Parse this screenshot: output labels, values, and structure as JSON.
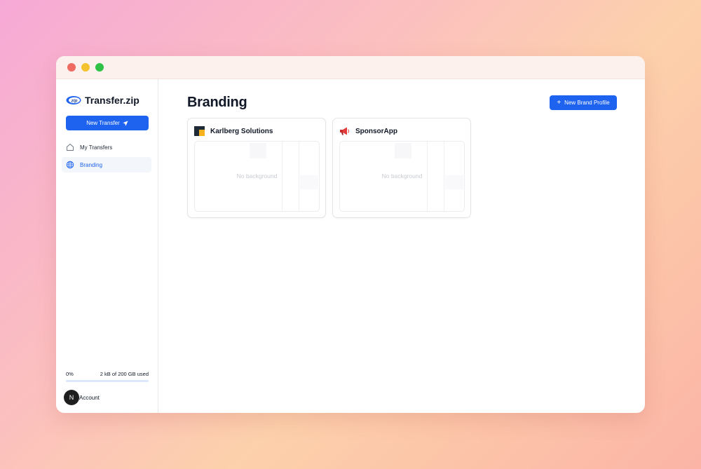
{
  "app": {
    "name": "Transfer.zip",
    "logo_text": "zip"
  },
  "sidebar": {
    "new_transfer_label": "New Transfer",
    "items": [
      {
        "label": "My Transfers",
        "icon": "home-icon",
        "active": false
      },
      {
        "label": "Branding",
        "icon": "globe-icon",
        "active": true
      }
    ],
    "storage": {
      "percent_label": "0%",
      "usage_label": "2 kB of 200 GB used",
      "fraction_used": 0
    },
    "account": {
      "avatar_letter": "N",
      "label": "Account"
    }
  },
  "main": {
    "title": "Branding",
    "new_brand_label": "New Brand Profile",
    "profiles": [
      {
        "name": "Karlberg Solutions",
        "icon": "karlberg-logo-icon",
        "preview_text": "No background"
      },
      {
        "name": "SponsorApp",
        "icon": "megaphone-icon",
        "preview_text": "No background"
      }
    ]
  },
  "colors": {
    "accent": "#1d63f0",
    "traffic_red": "#ef6a60",
    "traffic_yellow": "#f5c22f",
    "traffic_green": "#2fc247"
  }
}
